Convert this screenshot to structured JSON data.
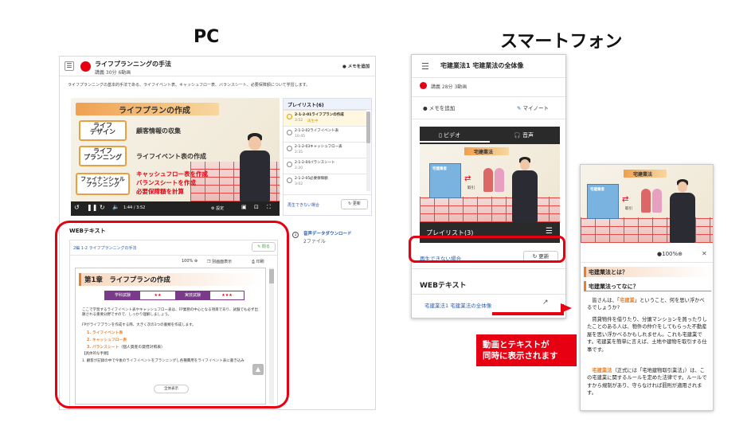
{
  "headings": {
    "pc": "PC",
    "sp": "スマートフォン"
  },
  "pc": {
    "title": "ライフプランニングの手法",
    "meta": "講義 30分 6動画",
    "memo_button": "メモを追加",
    "description": "ライフプランニングの基本的手法である、ライフイベント表、キャッシュフロー表、バランスシート、必要保障額について学習します。",
    "slide": {
      "title": "ライフプランの作成",
      "row1_box": "ライフ\nデザイン",
      "row1_text": "顧客情報の収集",
      "row2_box": "ライフ\nプランニング",
      "row2_text": "ライフイベント表の作成",
      "row3_box": "ファイナンシャル\nプランニング",
      "row3_red1": "キャッシュフロー表を作成",
      "row3_red2": "バランスシートを作成",
      "row3_red3": "必要保障額を計算"
    },
    "player": {
      "time": "1:44 / 3:52",
      "settings": "設定"
    },
    "playlist": {
      "header": "プレイリスト(6)",
      "items": [
        {
          "title": "2-1-2-01ライフプランの作成",
          "duration": "3:52",
          "status": "再生中"
        },
        {
          "title": "2-1-2-02ライフイベント表",
          "duration": "10:45",
          "status": ""
        },
        {
          "title": "2-1-2-03キャッシュフロー表",
          "duration": "2:35",
          "status": ""
        },
        {
          "title": "2-1-2-04バランスシート",
          "duration": "2:20",
          "status": ""
        },
        {
          "title": "2-1-2-05必要保障額",
          "duration": "3:02",
          "status": ""
        }
      ],
      "cannot_play": "再生できない場合",
      "refresh": "更新"
    },
    "download": {
      "title": "音声データダウンロード",
      "sub": "2ファイル"
    },
    "webtext": {
      "label": "WEBテキスト",
      "breadcrumb": "2編 1-2 ライフプランニングの手法",
      "hide": "閉る",
      "zoom": "100%",
      "new_window": "別画面表示",
      "print": "印刷",
      "chapter": "第1章　ライフプランの作成",
      "exam1_label": "学科試験",
      "exam1_stars": "★★",
      "exam2_label": "実技試験",
      "exam2_stars": "★★★",
      "para1": "ここで学習するライフイベント表やキャッシュフロー表は、FP業務の中心となる項目であり、試験でも必ず出題される重要分野ですので、しっかり理解しましょう。",
      "para2": "FPがライフプランを作成する際、大きく次の3つの書類を作成します。",
      "list1": "1. ライフイベント表",
      "list2": "2. キャッシュフロー表",
      "list3": "3. バランスシート",
      "list3_note": "（個人資産の貸借対照表）",
      "sub": "【具体的な手順】",
      "para3": "1. 顧客が記録の中で今後のライフイベントをプランニングし各種費用をライフイベント表に書き込み",
      "show_all": "全体表示"
    }
  },
  "sp1": {
    "title": "宅建業法1 宅建業法の全体像",
    "meta": "講義 28分 3動画",
    "memo_button": "メモを追加",
    "mynote": "マイノート",
    "tab_video": "ビデオ",
    "tab_audio": "音声",
    "slide_title": "宅建業法",
    "building_label": "宅建業者",
    "arrow_label": "取引",
    "playlist": "プレイリスト(3)",
    "cannot_play": "再生できない場合",
    "refresh": "更新",
    "webtext_label": "WEBテキスト",
    "webtext_link": "宅建業法1 宅建業法の全体像"
  },
  "sp2": {
    "slide_title": "宅建業法",
    "building_label": "宅建業者",
    "arrow_label": "取引",
    "zoom": "100%",
    "heading1": "宅建業法とは？",
    "heading2": "宅建業法ってなに？",
    "p1a": "皆さんは、「",
    "p1b": "宅建業",
    "p1c": "」ということ、何を思い浮かべるでしょうか?",
    "p2": "賃貸物件を借りたり、分譲マンションを買ったりしたことのある人は、物件の仲介をしてもらった不動産屋を思い浮かべるかもしれません。これも宅建業です。宅建業を簡単に言えば、土地や建物を取引する仕事です。",
    "p3a": "宅建業法",
    "p3b": "（正式には「宅地建物取引業法」）は、この宅建業に関するルールを定めた法律です。ルールですから規制があり、守らなければ罰則が適用されます。"
  },
  "callout": {
    "line1": "動画とテキストが",
    "line2": "同時に表示されます"
  },
  "colors": {
    "accent_red": "#e60012",
    "orange": "#f0a050",
    "link_blue": "#2a5bb0"
  }
}
